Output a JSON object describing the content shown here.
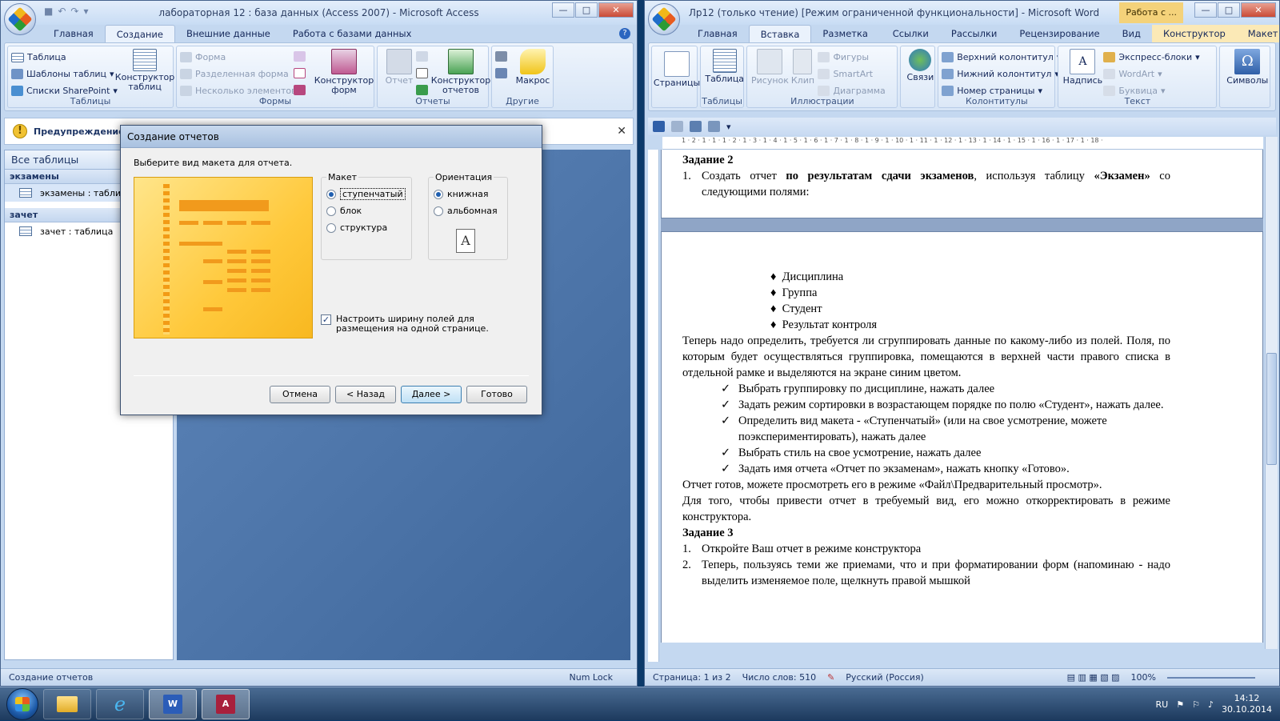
{
  "access": {
    "title": "лабораторная 12 : база данных (Access 2007)  -  Microsoft Access",
    "tabs": [
      "Главная",
      "Создание",
      "Внешние данные",
      "Работа с базами данных"
    ],
    "ribbon": {
      "tables": {
        "label": "Таблицы",
        "table": "Таблица",
        "templates": "Шаблоны таблиц",
        "sharepoint": "Списки SharePoint",
        "designer": "Конструктор таблиц"
      },
      "forms": {
        "label": "Формы",
        "form": "Форма",
        "split": "Разделенная форма",
        "multi": "Несколько элементов",
        "designer": "Конструктор форм"
      },
      "reports": {
        "label": "Отчеты",
        "report": "Отчет",
        "designer": "Конструктор отчетов"
      },
      "other": {
        "label": "Другие",
        "macro": "Макрос"
      }
    },
    "warning": "Предупреждение си",
    "nav": {
      "header": "Все таблицы",
      "groups": [
        {
          "name": "экзамены",
          "item": "экзамены : таблица"
        },
        {
          "name": "зачет",
          "item": "зачет : таблица"
        }
      ]
    },
    "status": {
      "left": "Создание отчетов",
      "right": "Num Lock"
    }
  },
  "dialog": {
    "title": "Создание отчетов",
    "prompt": "Выберите вид макета для отчета.",
    "layout": {
      "legend": "Макет",
      "options": [
        "ступенчатый",
        "блок",
        "структура"
      ],
      "selected": 0
    },
    "orientation": {
      "legend": "Ориентация",
      "options": [
        "книжная",
        "альбомная"
      ],
      "selected": 0
    },
    "checkbox": "Настроить ширину полей для размещения на одной странице.",
    "buttons": {
      "cancel": "Отмена",
      "back": "< Назад",
      "next": "Далее >",
      "finish": "Готово"
    }
  },
  "word": {
    "title": "Лр12 (только чтение) [Режим ограниченной функциональности] - Microsoft Word",
    "context": "Работа с ...",
    "tabs": [
      "Главная",
      "Вставка",
      "Разметка страницы",
      "Ссылки",
      "Рассылки",
      "Рецензирование",
      "Вид",
      "Конструктор",
      "Макет"
    ],
    "ribbon": {
      "pages": "Страницы",
      "tables": {
        "label": "Таблицы",
        "table": "Таблица"
      },
      "illustrations": {
        "label": "Иллюстрации",
        "picture": "Рисунок",
        "clip": "Клип",
        "shapes": "Фигуры",
        "smartart": "SmartArt",
        "chart": "Диаграмма"
      },
      "links": "Связи",
      "headers": {
        "label": "Колонтитулы",
        "header": "Верхний колонтитул",
        "footer": "Нижний колонтитул",
        "pagenum": "Номер страницы"
      },
      "text": {
        "label": "Текст",
        "textbox": "Надпись",
        "express": "Экспресс-блоки",
        "wordart": "WordArt",
        "dropcap": "Буквица"
      },
      "symbols": "Символы"
    },
    "ruler": "1 · 2 · 1 · 1 · 1 · 2 · 1 · 3 · 1 · 4 · 1 · 5 · 1 · 6 · 1 · 7 · 1 · 8 · 1 · 9 · 1 · 10 · 1 · 11 · 1 · 12 · 1 · 13 · 1 · 14 · 1 · 15 · 1 · 16 · 1 · 17 · 1 · 18 ·",
    "doc": {
      "task2": "Задание 2",
      "t2_item_pre": "Создать отчет ",
      "t2_item_b1": "по результатам сдачи экзаменов",
      "t2_item_mid": ", используя таблицу ",
      "t2_item_b2": "«Экзамен»",
      "t2_item_post": " со следующими полями:",
      "fields": [
        "Дисциплина",
        "Группа",
        "Студент",
        "Результат контроля"
      ],
      "para1": "Теперь надо определить, требуется ли сгруппировать данные по какому-либо из полей. Поля, по которым будет осуществляться группировка, помещаются в верхней части правого списка в отдельной рамке и выделяются на экране синим цветом.",
      "checks": [
        "Выбрать группировку по дисциплине, нажать далее",
        "Задать режим сортировки в возрастающем порядке по полю «Студент», нажать далее.",
        "Определить вид макета - «Ступенчатый» (или на свое усмотрение, можете поэкспериментировать), нажать далее",
        "Выбрать стиль на свое усмотрение, нажать далее",
        "Задать имя отчета «Отчет по экзаменам», нажать кнопку «Готово»."
      ],
      "para2": "Отчет готов, можете просмотреть его в режиме «Файл\\Предварительный просмотр».",
      "para3": "Для того, чтобы привести отчет в требуемый вид, его можно откорректировать в режиме конструктора.",
      "task3": "Задание 3",
      "t3_items": [
        "Откройте Ваш отчет в режиме конструктора",
        "Теперь, пользуясь теми же приемами, что и при форматировании форм (напоминаю - надо выделить изменяемое поле, щелкнуть правой мышкой"
      ]
    },
    "status": {
      "page": "Страница: 1 из 2",
      "words": "Число слов: 510",
      "lang": "Русский (Россия)",
      "zoom": "100%"
    }
  },
  "taskbar": {
    "lang": "RU",
    "time": "14:12",
    "date": "30.10.2014"
  }
}
